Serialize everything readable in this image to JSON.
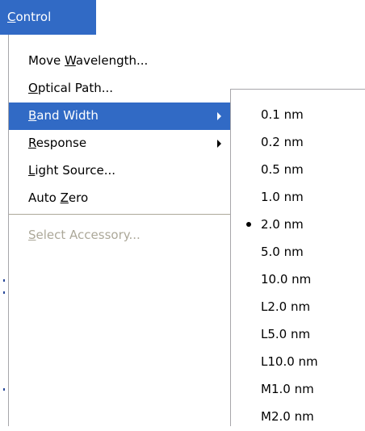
{
  "menubar": {
    "control": {
      "label_u": "C",
      "label_rest": "ontrol"
    }
  },
  "main_menu": {
    "items": [
      {
        "pre": "Move ",
        "u": "W",
        "post": "avelength..."
      },
      {
        "pre": "",
        "u": "O",
        "post": "ptical Path..."
      },
      {
        "pre": "",
        "u": "B",
        "post": "and Width"
      },
      {
        "pre": "",
        "u": "R",
        "post": "esponse"
      },
      {
        "pre": "",
        "u": "L",
        "post": "ight Source..."
      },
      {
        "pre": "Auto ",
        "u": "Z",
        "post": "ero"
      },
      {
        "pre": "",
        "u": "S",
        "post": "elect Accessory..."
      }
    ]
  },
  "band_width_submenu": {
    "checked": "2.0 nm",
    "items": [
      "0.1 nm",
      "0.2 nm",
      "0.5 nm",
      "1.0 nm",
      "2.0 nm",
      "5.0 nm",
      "10.0 nm",
      "L2.0 nm",
      "L5.0 nm",
      "L10.0 nm",
      "M1.0 nm",
      "M2.0 nm"
    ]
  },
  "colors": {
    "highlight": "#316ac5",
    "disabled_text": "#aca899"
  }
}
